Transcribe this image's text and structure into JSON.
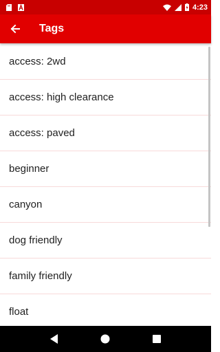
{
  "status_bar": {
    "time": "4:23",
    "icons": [
      "sd-card-icon",
      "alert-a-icon",
      "wifi-icon",
      "signal-icon",
      "battery-charging-icon"
    ]
  },
  "app_bar": {
    "title": "Tags",
    "back_icon": "arrow-back-icon"
  },
  "tags": [
    "access: 2wd",
    "access: high clearance",
    "access: paved",
    "beginner",
    "canyon",
    "dog friendly",
    "family friendly",
    "float"
  ],
  "nav_bar": {
    "icons": [
      "back-triangle-icon",
      "home-circle-icon",
      "recents-square-icon"
    ]
  },
  "colors": {
    "status_bar": "#c80000",
    "app_bar": "#e10000",
    "divider": "#f8dada",
    "text": "#212121"
  }
}
